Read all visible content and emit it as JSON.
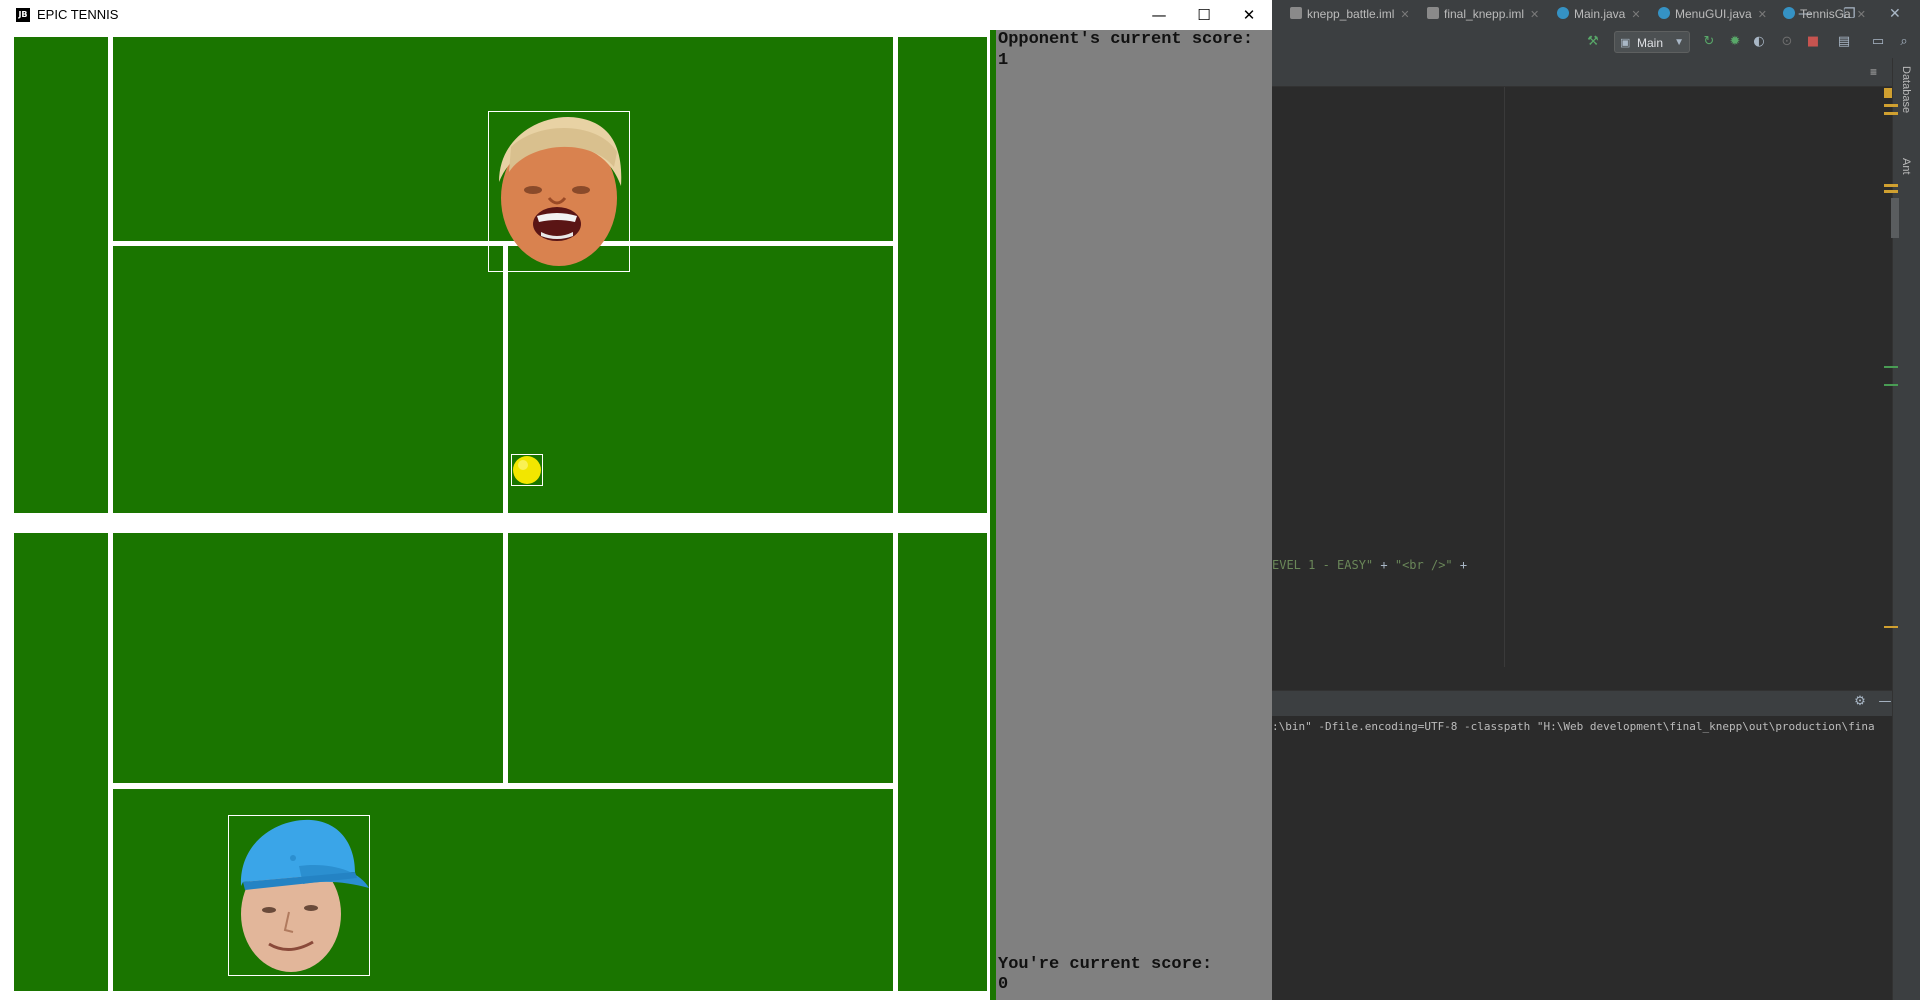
{
  "game": {
    "window_title": "EPIC TENNIS",
    "app_icon_text": "JB",
    "controls": {
      "minimize": "—",
      "maximize": "☐",
      "close": "✕"
    },
    "opponent_score_label": "Opponent's current score:",
    "opponent_score": "1",
    "player_score_label": "You're current score:",
    "player_score": "0",
    "colors": {
      "court": "#1a7500",
      "lines": "#ffffff",
      "panel": "#808080",
      "ball": "#f2e600"
    }
  },
  "ide": {
    "run_config": "Main",
    "tabs": [
      {
        "label": "knepp_battle.iml",
        "icon_color": "#8a8a8a"
      },
      {
        "label": "final_knepp.iml",
        "icon_color": "#8a8a8a"
      },
      {
        "label": "Main.java",
        "icon_color": "#3592c4"
      },
      {
        "label": "MenuGUI.java",
        "icon_color": "#3592c4"
      },
      {
        "label": "TennisGa",
        "icon_color": "#3592c4"
      }
    ],
    "tab_overflow": "≡",
    "code_snippet": {
      "string": "EVEL 1 - EASY\"",
      "op1": " + ",
      "string2": "\"<br />\"",
      "op2": " +"
    },
    "console_text": ":\\bin\" -Dfile.encoding=UTF-8 -classpath \"H:\\Web development\\final_knepp\\out\\production\\fina",
    "side_labels": [
      "Database",
      "Ant"
    ]
  }
}
